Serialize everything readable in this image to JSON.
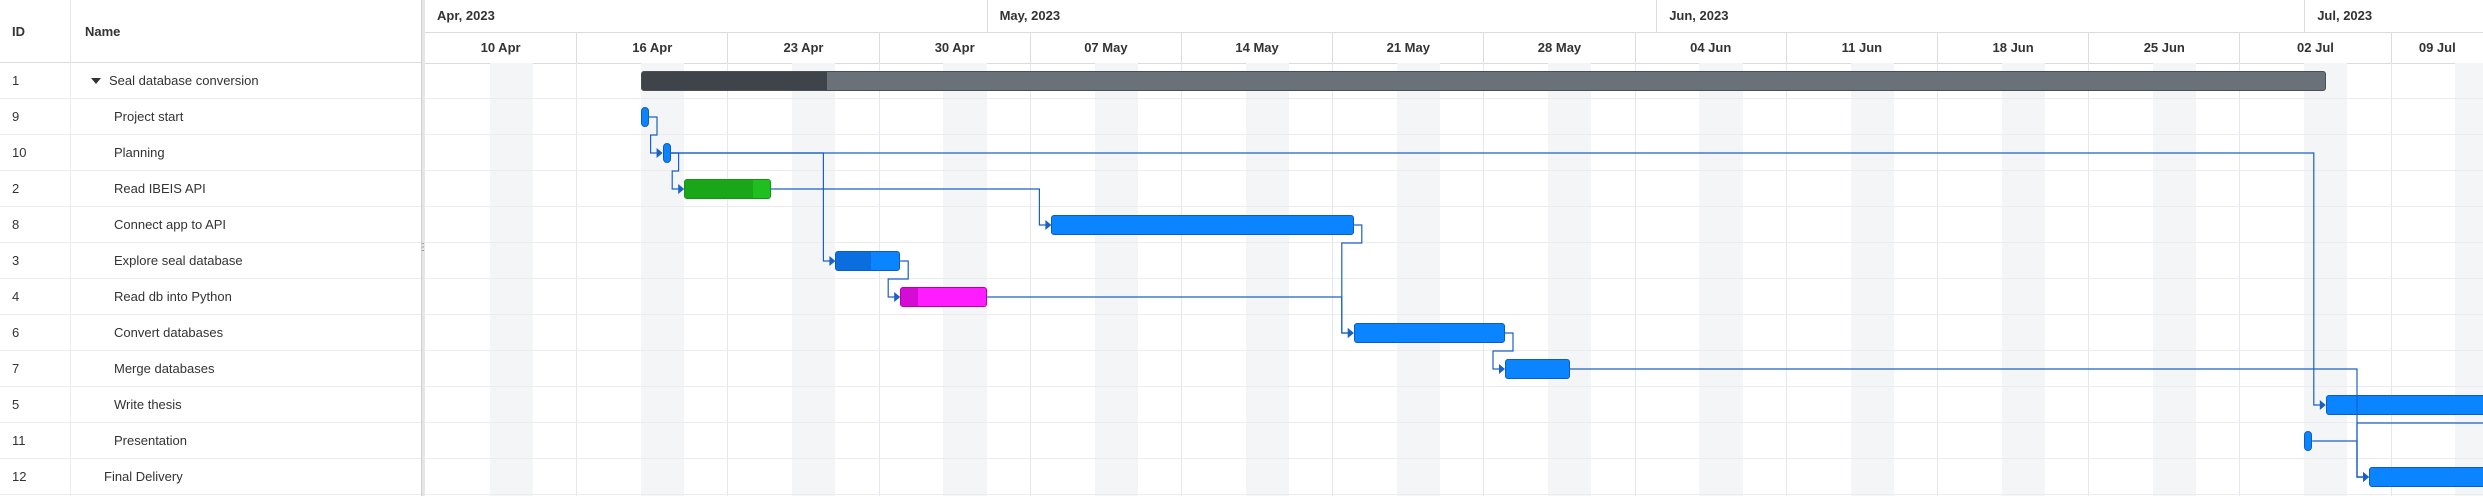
{
  "grid": {
    "col_id": "ID",
    "col_name": "Name",
    "rows": [
      {
        "id": "1",
        "name": "Seal database conversion",
        "level": "summary"
      },
      {
        "id": "9",
        "name": "Project start",
        "level": "child"
      },
      {
        "id": "10",
        "name": "Planning",
        "level": "child"
      },
      {
        "id": "2",
        "name": "Read IBEIS API",
        "level": "child"
      },
      {
        "id": "8",
        "name": "Connect app to API",
        "level": "child"
      },
      {
        "id": "3",
        "name": "Explore seal database",
        "level": "child"
      },
      {
        "id": "4",
        "name": "Read db into Python",
        "level": "child"
      },
      {
        "id": "6",
        "name": "Convert databases",
        "level": "child"
      },
      {
        "id": "7",
        "name": "Merge databases",
        "level": "child"
      },
      {
        "id": "5",
        "name": "Write thesis",
        "level": "child"
      },
      {
        "id": "11",
        "name": "Presentation",
        "level": "child"
      },
      {
        "id": "12",
        "name": "Final Delivery",
        "level": "top"
      }
    ]
  },
  "timeline": {
    "start_date": "2023-04-05",
    "months": [
      "Apr, 2023",
      "May, 2023",
      "Jun, 2023",
      "Jul, 2023"
    ],
    "weeks": [
      "10 Apr",
      "16 Apr",
      "23 Apr",
      "30 Apr",
      "07 May",
      "14 May",
      "21 May",
      "28 May",
      "04 Jun",
      "11 Jun",
      "18 Jun",
      "25 Jun",
      "02 Jul",
      "09 Jul"
    ]
  },
  "tasks": [
    {
      "row": 0,
      "type": "summary",
      "start": "2023-04-15",
      "end": "2023-07-01",
      "progress": 0.11
    },
    {
      "row": 1,
      "type": "milestone",
      "start": "2023-04-15",
      "end": "2023-04-15"
    },
    {
      "row": 2,
      "type": "milestone",
      "start": "2023-04-16",
      "end": "2023-04-16"
    },
    {
      "row": 3,
      "type": "task",
      "start": "2023-04-17",
      "end": "2023-04-20",
      "color": "#1fbf1f",
      "border": "#149414",
      "progress": 0.8
    },
    {
      "row": 4,
      "type": "task",
      "start": "2023-05-04",
      "end": "2023-05-17",
      "color": "#0a84ff",
      "border": "#0b5cc4",
      "progress": 0
    },
    {
      "row": 5,
      "type": "task",
      "start": "2023-04-24",
      "end": "2023-04-26",
      "color": "#0a84ff",
      "border": "#0b5cc4",
      "progress": 0.55
    },
    {
      "row": 6,
      "type": "task",
      "start": "2023-04-27",
      "end": "2023-04-30",
      "color": "#ff1cff",
      "border": "#b000b0",
      "progress": 0.2
    },
    {
      "row": 7,
      "type": "task",
      "start": "2023-05-18",
      "end": "2023-05-24",
      "color": "#0a84ff",
      "border": "#0b5cc4",
      "progress": 0
    },
    {
      "row": 8,
      "type": "task",
      "start": "2023-05-25",
      "end": "2023-05-27",
      "color": "#0a84ff",
      "border": "#0b5cc4",
      "progress": 0
    },
    {
      "row": 9,
      "type": "task",
      "start": "2023-07-02",
      "end": "2023-07-18",
      "color": "#0a84ff",
      "border": "#0b5cc4",
      "progress": 0
    },
    {
      "row": 10,
      "type": "milestone",
      "start": "2023-07-01",
      "end": "2023-07-01"
    },
    {
      "row": 11,
      "type": "task",
      "start": "2023-07-04",
      "end": "2023-07-10",
      "color": "#0a84ff",
      "border": "#0b5cc4",
      "progress": 0
    }
  ],
  "links": [
    {
      "from": 1,
      "to": 2
    },
    {
      "from": 2,
      "to": 3
    },
    {
      "from": 3,
      "to": 4
    },
    {
      "from": 2,
      "to": 5
    },
    {
      "from": 5,
      "to": 6
    },
    {
      "from": 4,
      "to": 7
    },
    {
      "from": 6,
      "to": 7
    },
    {
      "from": 7,
      "to": 8
    },
    {
      "from": 2,
      "to": 9
    },
    {
      "from": 8,
      "to": 11
    },
    {
      "from": 9,
      "to": 11
    },
    {
      "from": 10,
      "to": 11
    }
  ],
  "colors": {
    "summary_bar": "#6b7178",
    "summary_progress": "#3f444a",
    "link": "#1a61c2",
    "milestone": "#0a84ff",
    "weekend": "#f4f5f7",
    "grid_line": "#e4e7ec"
  },
  "icons": {
    "expand": "caret-down-icon",
    "splitter": "drag-handle-icon"
  }
}
